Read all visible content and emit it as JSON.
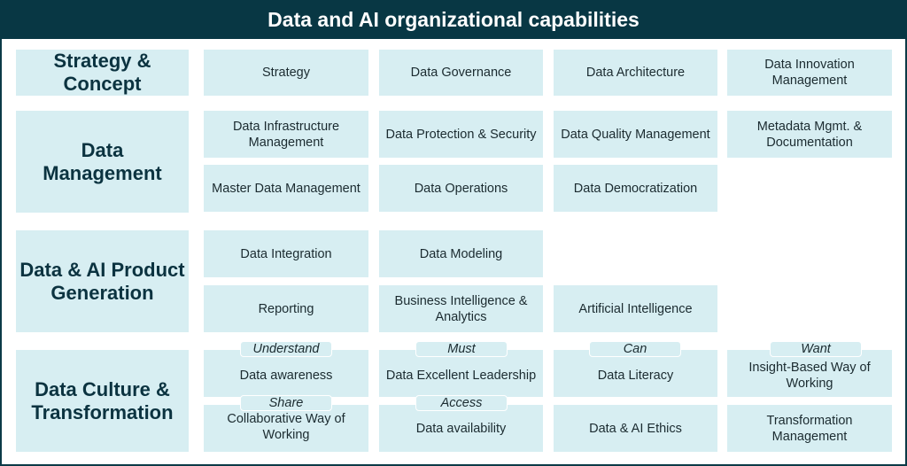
{
  "title": "Data and AI organizational capabilities",
  "colors": {
    "header_bg": "#083744",
    "tile_bg": "#d7eef2",
    "category_text": "#0b3340"
  },
  "categories": [
    {
      "label": "Strategy & Concept",
      "items": [
        "Strategy",
        "Data Governance",
        "Data Architecture",
        "Data Innovation Management"
      ]
    },
    {
      "label": "Data Management",
      "items": [
        "Data Infrastructure Management",
        "Data Protection & Security",
        "Data Quality Management",
        "Metadata Mgmt. & Documentation",
        "Master Data Management",
        "Data Operations",
        "Data Democratization"
      ]
    },
    {
      "label": "Data & AI Product Generation",
      "items": [
        "Data Integration",
        "Data Modeling",
        "Reporting",
        "Business Intelligence & Analytics",
        "Artificial Intelligence"
      ]
    },
    {
      "label": "Data Culture & Transformation",
      "items": [
        "Data awareness",
        "Data Excellent Leadership",
        "Data Literacy",
        "Insight-Based Way of Working",
        "Collaborative Way of Working",
        "Data availability",
        "Data & AI Ethics",
        "Transformation Management"
      ],
      "tags": [
        "Understand",
        "Must",
        "Can",
        "Want",
        "Share",
        "Access"
      ]
    }
  ]
}
